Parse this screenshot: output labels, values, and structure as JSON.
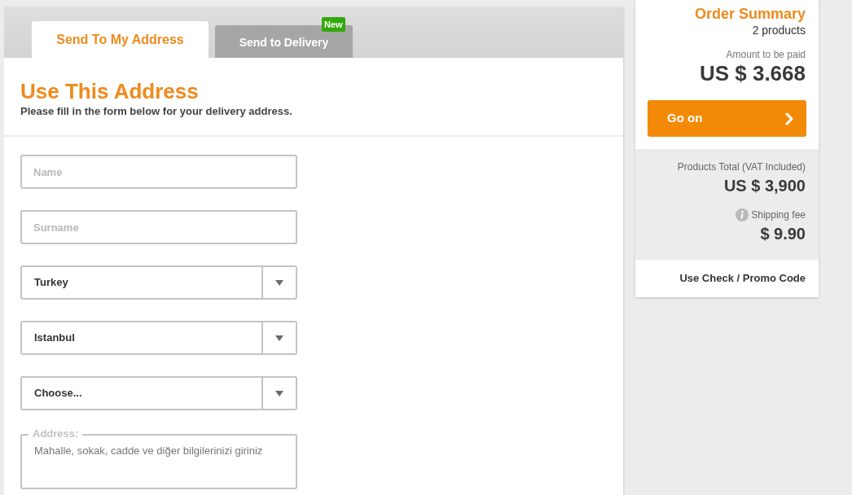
{
  "tabs": [
    {
      "label": "Send To My Address",
      "selected": true
    },
    {
      "label": "Send to Delivery",
      "selected": false,
      "badge": "New"
    }
  ],
  "address_form": {
    "title": "Use This Address",
    "subtitle": "Please fill in the form below for your delivery address.",
    "fields": [
      {
        "kind": "text",
        "placeholder": "Name"
      },
      {
        "kind": "text",
        "placeholder": "Surname"
      },
      {
        "kind": "select",
        "value": "Turkey"
      },
      {
        "kind": "select",
        "value": "Istanbul"
      },
      {
        "kind": "select",
        "value": "Choose..."
      },
      {
        "kind": "textarea",
        "label": "Address:",
        "placeholder": "Mahalle, sokak, cadde ve diğer bilgilerinizi giriniz"
      }
    ]
  },
  "order_summary": {
    "title": "Order Summary",
    "product_count": "2 products",
    "amount_label": "Amount to be paid",
    "amount": "US $ 3.668",
    "button": "Go on",
    "products_total_label": "Products Total (VAT Included)",
    "products_total": "US $ 3,900",
    "shipping_label": "Shipping fee",
    "shipping_fee": "$ 9.90",
    "promo_link": "Use Check / Promo Code"
  }
}
